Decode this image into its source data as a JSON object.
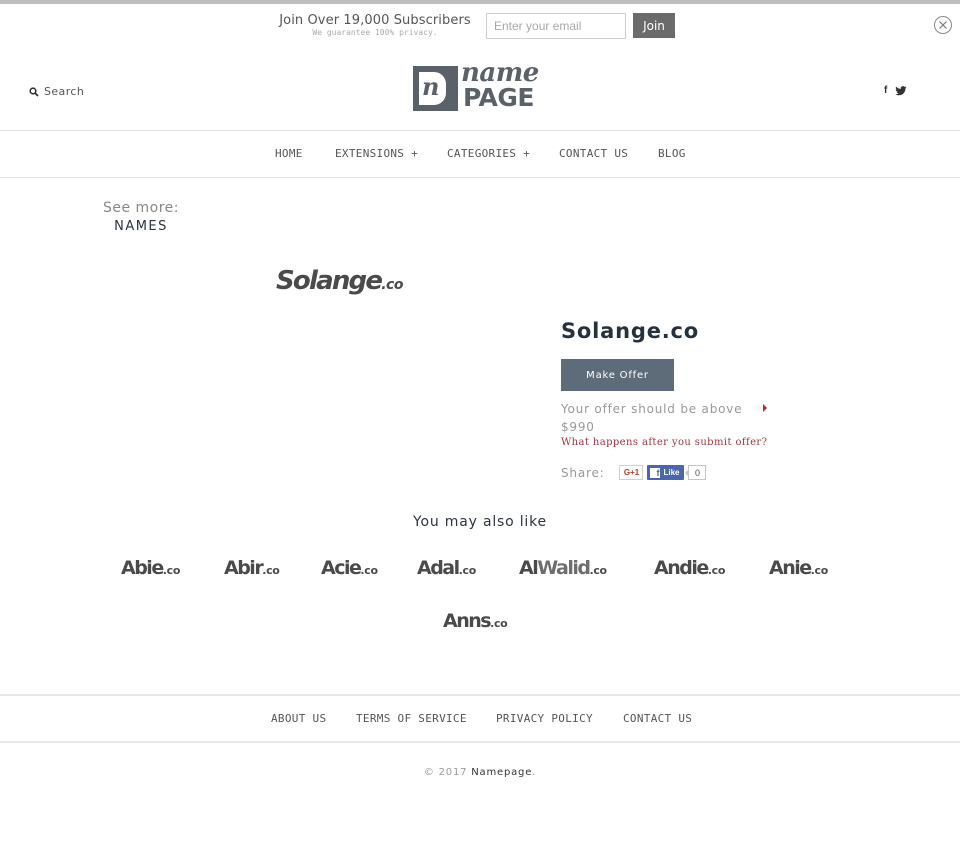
{
  "subscribe": {
    "title": "Join Over 19,000 Subscribers",
    "subtitle": "We guarantee 100% privacy.",
    "email_value": "",
    "email_placeholder": "Enter your email",
    "join_label": "Join"
  },
  "header": {
    "search_label": "Search",
    "logo": {
      "monogram": "n",
      "top_word": "name",
      "bottom_word": "PAGE"
    },
    "social": {
      "facebook": "f"
    }
  },
  "nav": {
    "items": [
      {
        "label": "HOME"
      },
      {
        "label": "EXTENSIONS +"
      },
      {
        "label": "CATEGORIES +"
      },
      {
        "label": "CONTACT US"
      },
      {
        "label": "BLOG"
      }
    ]
  },
  "see_more": {
    "label": "See more:",
    "link": "NAMES"
  },
  "product": {
    "logo_name": "Solange",
    "logo_tld": ".co",
    "title": "Solange.co",
    "make_offer_label": "Make Offer",
    "offer_note": "Your offer should be above $990",
    "what_happens": "What happens after you submit offer?",
    "share_label": "Share:",
    "gplus_label": "G+1",
    "fb_like_label": "Like",
    "fb_like_count": "0"
  },
  "related": {
    "title": "You may also like",
    "items": [
      {
        "name": "Abie",
        "tld": ".co"
      },
      {
        "name": "Abir",
        "tld": ".co"
      },
      {
        "name": "Acie",
        "tld": ".co"
      },
      {
        "name": "Adal",
        "tld": ".co"
      },
      {
        "name": "Al",
        "name2": "Walid",
        "tld": ".co"
      },
      {
        "name": "Andie",
        "tld": ".co"
      },
      {
        "name": "Anie",
        "tld": ".co"
      },
      {
        "name": "Anns",
        "tld": ".co"
      }
    ]
  },
  "footer": {
    "links": [
      {
        "label": "ABOUT US"
      },
      {
        "label": "TERMS OF SERVICE"
      },
      {
        "label": "PRIVACY POLICY"
      },
      {
        "label": "CONTACT US"
      }
    ],
    "copyright_prefix": "© 2017",
    "copyright_brand": "Namepage",
    "copyright_suffix": "."
  }
}
